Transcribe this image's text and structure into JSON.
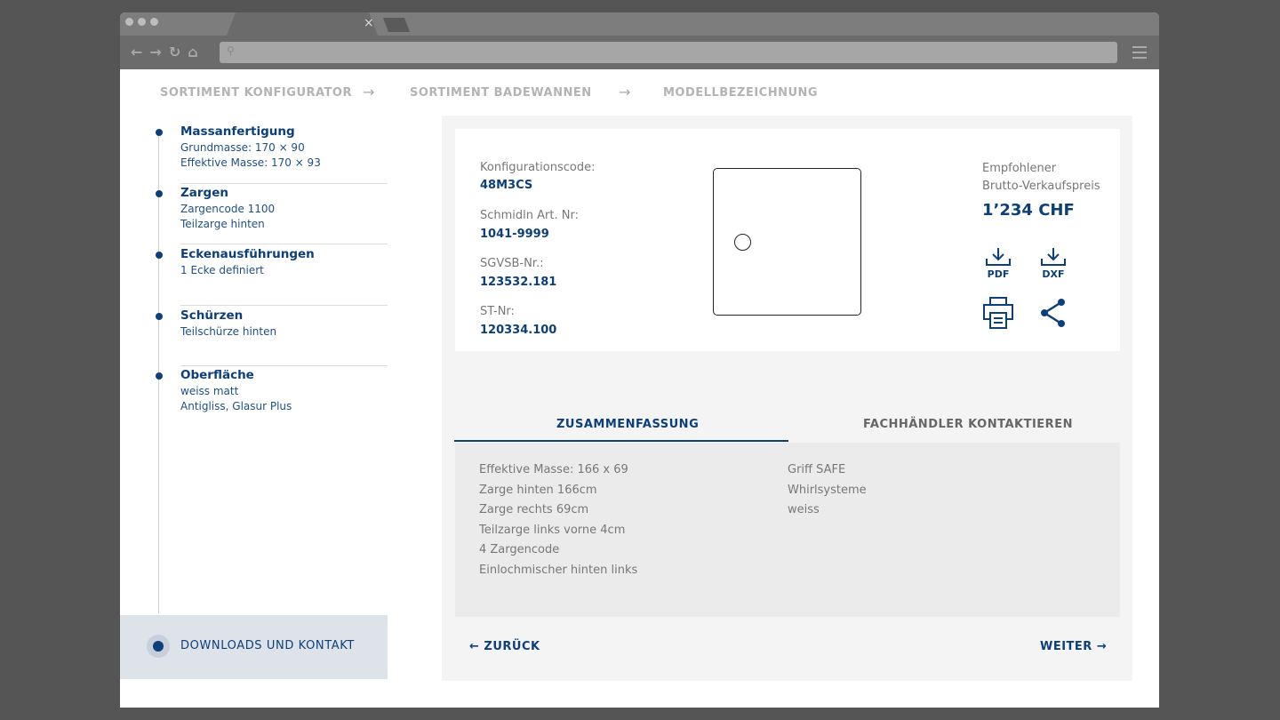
{
  "breadcrumb": [
    "SORTIMENT KONFIGURATOR",
    "SORTIMENT BADEWANNEN",
    "MODELLBEZEICHNUNG"
  ],
  "steps": [
    {
      "title": "Massanfertigung",
      "lines": [
        "Grundmasse: 170 × 90",
        "Effektive Masse: 170 × 93"
      ]
    },
    {
      "title": "Zargen",
      "lines": [
        "Zargencode 1100",
        "Teilzarge hinten"
      ]
    },
    {
      "title": "Eckenausführungen",
      "lines": [
        "1 Ecke definiert"
      ]
    },
    {
      "title": "Schürzen",
      "lines": [
        "Teilschürze hinten"
      ]
    },
    {
      "title": "Oberfläche",
      "lines": [
        "weiss matt",
        "Antigliss, Glasur Plus"
      ]
    }
  ],
  "active_step": "DOWNLOADS UND KONTAKT",
  "details": [
    {
      "label": "Konfigurationscode:",
      "value": "48M3CS"
    },
    {
      "label": "Schmidln Art. Nr:",
      "value": "1041-9999"
    },
    {
      "label": "SGVSB-Nr.:",
      "value": "123532.181"
    },
    {
      "label": "ST-Nr:",
      "value": "120334.100"
    }
  ],
  "price": {
    "label1": "Empfohlener",
    "label2": "Brutto-Verkaufspreis",
    "value": "1’234 CHF"
  },
  "downloads": {
    "pdf": "PDF",
    "dxf": "DXF"
  },
  "tabs": [
    "ZUSAMMENFASSUNG",
    "FACHHÄNDLER KONTAKTIEREN"
  ],
  "summary_left": [
    "Effektive Masse: 166 x 69",
    "Zarge hinten 166cm",
    "Zarge rechts 69cm",
    "Teilzarge links vorne 4cm",
    "4 Zargencode",
    "Einlochmischer hinten links"
  ],
  "summary_right": [
    "Griff SAFE",
    "Whirlsysteme",
    "weiss"
  ],
  "nav": {
    "back": "← ZURÜCK",
    "next": "WEITER →"
  },
  "browser": {
    "close": "×",
    "search_icon": "⚲"
  }
}
